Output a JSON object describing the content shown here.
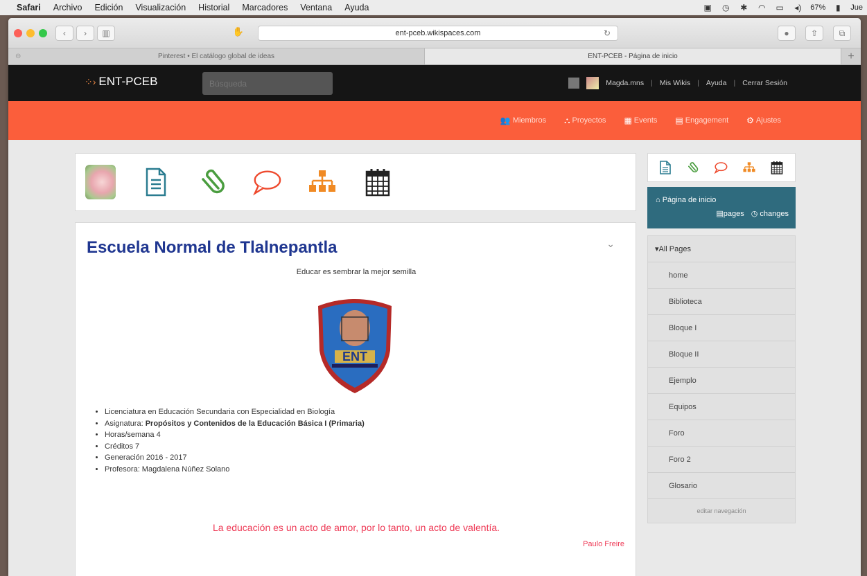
{
  "menubar": {
    "items": [
      "Safari",
      "Archivo",
      "Edición",
      "Visualización",
      "Historial",
      "Marcadores",
      "Ventana",
      "Ayuda"
    ],
    "battery": "67%",
    "clock": "Jue"
  },
  "browser": {
    "url": "ent-pceb.wikispaces.com",
    "tabs": [
      {
        "label": "Pinterest • El catálogo global de ideas"
      },
      {
        "label": "ENT-PCEB - Página de inicio"
      }
    ]
  },
  "site": {
    "logo": "ENT-PCEB",
    "search_placeholder": "Búsqueda",
    "user": {
      "name": "Magda.mns",
      "links": [
        "Mis Wikis",
        "Ayuda",
        "Cerrar Sesión"
      ]
    },
    "nav": [
      {
        "icon": "members-icon",
        "label": "Miembros"
      },
      {
        "icon": "projects-icon",
        "label": "Proyectos"
      },
      {
        "icon": "events-icon",
        "label": "Events"
      },
      {
        "icon": "engagement-icon",
        "label": "Engagement"
      },
      {
        "icon": "settings-icon",
        "label": "Ajustes"
      }
    ]
  },
  "page": {
    "title": "Escuela Normal de Tlalnepantla",
    "tagline": "Educar es sembrar la mejor semilla",
    "shield_text": "ENT",
    "bullets": [
      {
        "text": "Licenciatura en Educación Secundaria con Especialidad en Biología"
      },
      {
        "prefix": "Asignatura: ",
        "bold": "Propósitos y Contenidos de la Educación Básica I (Primaria)"
      },
      {
        "text": "Horas/semana 4"
      },
      {
        "text": "Créditos 7"
      },
      {
        "text": "Generación 2016 - 2017"
      },
      {
        "text": "Profesora: Magdalena Núñez Solano"
      }
    ],
    "quote": "La educación es un acto de amor, por lo tanto, un acto de valentía.",
    "author": "Paulo Freire"
  },
  "sidebar": {
    "home_title": "Página de inicio",
    "pages_label": "pages",
    "changes_label": "changes",
    "all_pages": "All Pages",
    "pages": [
      "home",
      "Biblioteca",
      "Bloque I",
      "Bloque II",
      "Ejemplo",
      "Equipos",
      "Foro",
      "Foro 2",
      "Glosario"
    ],
    "edit_nav": "editar navegación"
  },
  "colors": {
    "nav_orange": "#fb5e3b",
    "title_blue": "#1f3690",
    "quote_red": "#ee3a56",
    "sidebar_teal": "#2f6b7e"
  }
}
